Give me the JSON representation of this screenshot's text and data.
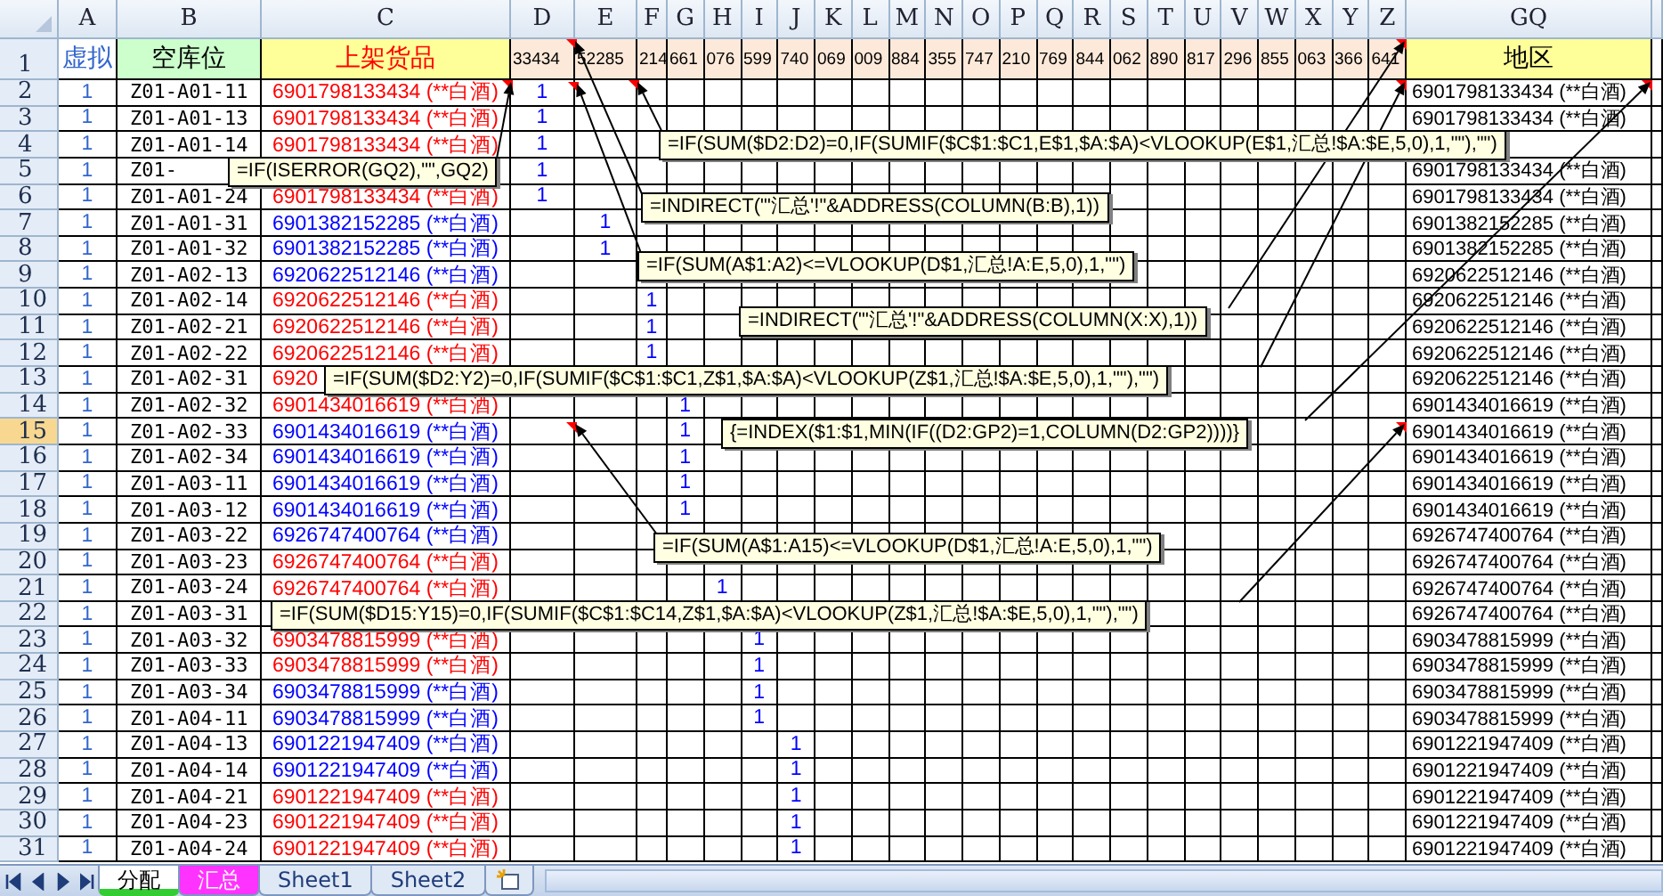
{
  "sheet": {
    "column_headers": [
      "A",
      "B",
      "C",
      "D",
      "E",
      "F",
      "G",
      "H",
      "I",
      "J",
      "K",
      "L",
      "M",
      "N",
      "O",
      "P",
      "Q",
      "R",
      "S",
      "T",
      "U",
      "V",
      "W",
      "X",
      "Y",
      "Z",
      "GQ"
    ],
    "header_row": {
      "row_number": "1",
      "cells": [
        "虚拟",
        "空库位",
        "上架货品",
        "33434",
        "52285",
        "214",
        "661",
        "076",
        "599",
        "740",
        "069",
        "009",
        "884",
        "355",
        "747",
        "210",
        "769",
        "844",
        "062",
        "890",
        "817",
        "296",
        "855",
        "063",
        "366",
        "641",
        "地区"
      ]
    },
    "rows": [
      {
        "row_number": "2",
        "selected": false,
        "a": "1",
        "b": "Z01-A01-11",
        "c": {
          "text": "6901798133434 (**白酒)",
          "color": "#ff0000"
        },
        "marker_text": "1",
        "marker_cells": [
          true,
          false,
          false,
          false,
          false,
          false,
          false,
          false,
          false,
          false,
          false,
          false,
          false,
          false,
          false,
          false,
          false,
          false,
          false,
          false,
          false,
          false,
          false
        ],
        "gq": "6901798133434 (**白酒)"
      },
      {
        "row_number": "3",
        "selected": false,
        "a": "1",
        "b": "Z01-A01-13",
        "c": {
          "text": "6901798133434 (**白酒)",
          "color": "#ff0000"
        },
        "marker_text": "1",
        "marker_cells": [
          true,
          false,
          false,
          false,
          false,
          false,
          false,
          false,
          false,
          false,
          false,
          false,
          false,
          false,
          false,
          false,
          false,
          false,
          false,
          false,
          false,
          false,
          false
        ],
        "gq": "6901798133434 (**白酒)"
      },
      {
        "row_number": "4",
        "selected": false,
        "a": "1",
        "b": "Z01-A01-14",
        "c": {
          "text": "6901798133434 (**白酒)",
          "color": "#ff0000"
        },
        "marker_text": "1",
        "marker_cells": [
          true,
          false,
          false,
          false,
          false,
          false,
          false,
          false,
          false,
          false,
          false,
          false,
          false,
          false,
          false,
          false,
          false,
          false,
          false,
          false,
          false,
          false,
          false
        ]
      },
      {
        "row_number": "5",
        "selected": false,
        "a": "1",
        "b": "Z01-",
        "marker_text": "1",
        "marker_cells": [
          true,
          false,
          false,
          false,
          false,
          false,
          false,
          false,
          false,
          false,
          false,
          false,
          false,
          false,
          false,
          false,
          false,
          false,
          false,
          false,
          false,
          false,
          false
        ],
        "gq": "6901798133434 (**白酒)"
      },
      {
        "row_number": "6",
        "selected": false,
        "a": "1",
        "b": "Z01-A01-24",
        "c": {
          "text": "6901798133434 (**白酒)",
          "color": "#ff0000"
        },
        "marker_text": "1",
        "marker_cells": [
          true,
          false,
          false,
          false,
          false,
          false,
          false,
          false,
          false,
          false,
          false,
          false,
          false,
          false,
          false,
          false,
          false,
          false,
          false,
          false,
          false,
          false,
          false
        ],
        "gq": "6901798133434 (**白酒)"
      },
      {
        "row_number": "7",
        "selected": false,
        "a": "1",
        "b": "Z01-A01-31",
        "c": {
          "text": "6901382152285 (**白酒)",
          "color": "#0000ff"
        },
        "marker_text": "1",
        "marker_cells": [
          false,
          true,
          false,
          false,
          false,
          false,
          false,
          false,
          false,
          false,
          false,
          false,
          false,
          false,
          false,
          false,
          false,
          false,
          false,
          false,
          false,
          false,
          false
        ],
        "gq": "6901382152285 (**白酒)"
      },
      {
        "row_number": "8",
        "selected": false,
        "a": "1",
        "b": "Z01-A01-32",
        "c": {
          "text": "6901382152285 (**白酒)",
          "color": "#0000ff"
        },
        "marker_text": "1",
        "marker_cells": [
          false,
          true,
          false,
          false,
          false,
          false,
          false,
          false,
          false,
          false,
          false,
          false,
          false,
          false,
          false,
          false,
          false,
          false,
          false,
          false,
          false,
          false,
          false
        ],
        "gq": "6901382152285 (**白酒)"
      },
      {
        "row_number": "9",
        "selected": false,
        "a": "1",
        "b": "Z01-A02-13",
        "c": {
          "text": "6920622512146 (**白酒)",
          "color": "#0000ff"
        },
        "gq": "6920622512146 (**白酒)"
      },
      {
        "row_number": "10",
        "selected": false,
        "a": "1",
        "b": "Z01-A02-14",
        "c": {
          "text": "6920622512146 (**白酒)",
          "color": "#ff0000"
        },
        "marker_text": "1",
        "marker_cells": [
          false,
          false,
          true,
          false,
          false,
          false,
          false,
          false,
          false,
          false,
          false,
          false,
          false,
          false,
          false,
          false,
          false,
          false,
          false,
          false,
          false,
          false,
          false
        ],
        "gq": "6920622512146 (**白酒)"
      },
      {
        "row_number": "11",
        "selected": false,
        "a": "1",
        "b": "Z01-A02-21",
        "c": {
          "text": "6920622512146 (**白酒)",
          "color": "#ff0000"
        },
        "marker_text": "1",
        "marker_cells": [
          false,
          false,
          true,
          false,
          false,
          false,
          false,
          false,
          false,
          false,
          false,
          false,
          false,
          false,
          false,
          false,
          false,
          false,
          false,
          false,
          false,
          false,
          false
        ],
        "gq": "6920622512146 (**白酒)"
      },
      {
        "row_number": "12",
        "selected": false,
        "a": "1",
        "b": "Z01-A02-22",
        "c": {
          "text": "6920622512146 (**白酒)",
          "color": "#ff0000"
        },
        "marker_text": "1",
        "marker_cells": [
          false,
          false,
          true,
          false,
          false,
          false,
          false,
          false,
          false,
          false,
          false,
          false,
          false,
          false,
          false,
          false,
          false,
          false,
          false,
          false,
          false,
          false,
          false
        ],
        "gq": "6920622512146 (**白酒)"
      },
      {
        "row_number": "13",
        "selected": false,
        "a": "1",
        "b": "Z01-A02-31",
        "c": {
          "text": "6920",
          "color": "#ff0000"
        },
        "gq": "6920622512146 (**白酒)"
      },
      {
        "row_number": "14",
        "selected": false,
        "a": "1",
        "b": "Z01-A02-32",
        "c": {
          "text": "6901434016619 (**白酒)",
          "color": "#ff0000"
        },
        "marker_text": "1",
        "marker_cells": [
          false,
          false,
          false,
          true,
          false,
          false,
          false,
          false,
          false,
          false,
          false,
          false,
          false,
          false,
          false,
          false,
          false,
          false,
          false,
          false,
          false,
          false,
          false
        ],
        "gq": "6901434016619 (**白酒)"
      },
      {
        "row_number": "15",
        "selected": true,
        "a": "1",
        "b": "Z01-A02-33",
        "c": {
          "text": "6901434016619 (**白酒)",
          "color": "#0000ff"
        },
        "marker_text": "1",
        "marker_cells": [
          false,
          false,
          false,
          true,
          false,
          false,
          false,
          false,
          false,
          false,
          false,
          false,
          false,
          false,
          false,
          false,
          false,
          false,
          false,
          false,
          false,
          false,
          false
        ],
        "gq": "6901434016619 (**白酒)"
      },
      {
        "row_number": "16",
        "selected": false,
        "a": "1",
        "b": "Z01-A02-34",
        "c": {
          "text": "6901434016619 (**白酒)",
          "color": "#0000ff"
        },
        "marker_text": "1",
        "marker_cells": [
          false,
          false,
          false,
          true,
          false,
          false,
          false,
          false,
          false,
          false,
          false,
          false,
          false,
          false,
          false,
          false,
          false,
          false,
          false,
          false,
          false,
          false,
          false
        ],
        "gq": "6901434016619 (**白酒)"
      },
      {
        "row_number": "17",
        "selected": false,
        "a": "1",
        "b": "Z01-A03-11",
        "c": {
          "text": "6901434016619 (**白酒)",
          "color": "#0000ff"
        },
        "marker_text": "1",
        "marker_cells": [
          false,
          false,
          false,
          true,
          false,
          false,
          false,
          false,
          false,
          false,
          false,
          false,
          false,
          false,
          false,
          false,
          false,
          false,
          false,
          false,
          false,
          false,
          false
        ],
        "gq": "6901434016619 (**白酒)"
      },
      {
        "row_number": "18",
        "selected": false,
        "a": "1",
        "b": "Z01-A03-12",
        "c": {
          "text": "6901434016619 (**白酒)",
          "color": "#0000ff"
        },
        "marker_text": "1",
        "marker_cells": [
          false,
          false,
          false,
          true,
          false,
          false,
          false,
          false,
          false,
          false,
          false,
          false,
          false,
          false,
          false,
          false,
          false,
          false,
          false,
          false,
          false,
          false,
          false
        ],
        "gq": "6901434016619 (**白酒)"
      },
      {
        "row_number": "19",
        "selected": false,
        "a": "1",
        "b": "Z01-A03-22",
        "c": {
          "text": "6926747400764 (**白酒)",
          "color": "#0000ff"
        },
        "gq": "6926747400764 (**白酒)"
      },
      {
        "row_number": "20",
        "selected": false,
        "a": "1",
        "b": "Z01-A03-23",
        "c": {
          "text": "6926747400764 (**白酒)",
          "color": "#ff0000"
        },
        "gq": "6926747400764 (**白酒)"
      },
      {
        "row_number": "21",
        "selected": false,
        "a": "1",
        "b": "Z01-A03-24",
        "c": {
          "text": "6926747400764 (**白酒)",
          "color": "#ff0000"
        },
        "marker_text": "1",
        "marker_cells": [
          false,
          false,
          false,
          false,
          true,
          false,
          false,
          false,
          false,
          false,
          false,
          false,
          false,
          false,
          false,
          false,
          false,
          false,
          false,
          false,
          false,
          false,
          false
        ],
        "gq": "6926747400764 (**白酒)"
      },
      {
        "row_number": "22",
        "selected": false,
        "a": "1",
        "b": "Z01-A03-31",
        "gq": "6926747400764 (**白酒)"
      },
      {
        "row_number": "23",
        "selected": false,
        "a": "1",
        "b": "Z01-A03-32",
        "c": {
          "text": "6903478815999 (**白酒)",
          "color": "#ff0000"
        },
        "marker_text": "1",
        "marker_cells": [
          false,
          false,
          false,
          false,
          false,
          true,
          false,
          false,
          false,
          false,
          false,
          false,
          false,
          false,
          false,
          false,
          false,
          false,
          false,
          false,
          false,
          false,
          false
        ],
        "gq": "6903478815999 (**白酒)"
      },
      {
        "row_number": "24",
        "selected": false,
        "a": "1",
        "b": "Z01-A03-33",
        "c": {
          "text": "6903478815999 (**白酒)",
          "color": "#ff0000"
        },
        "marker_text": "1",
        "marker_cells": [
          false,
          false,
          false,
          false,
          false,
          true,
          false,
          false,
          false,
          false,
          false,
          false,
          false,
          false,
          false,
          false,
          false,
          false,
          false,
          false,
          false,
          false,
          false
        ],
        "gq": "6903478815999 (**白酒)"
      },
      {
        "row_number": "25",
        "selected": false,
        "a": "1",
        "b": "Z01-A03-34",
        "c": {
          "text": "6903478815999 (**白酒)",
          "color": "#0000ff"
        },
        "marker_text": "1",
        "marker_cells": [
          false,
          false,
          false,
          false,
          false,
          true,
          false,
          false,
          false,
          false,
          false,
          false,
          false,
          false,
          false,
          false,
          false,
          false,
          false,
          false,
          false,
          false,
          false
        ],
        "gq": "6903478815999 (**白酒)"
      },
      {
        "row_number": "26",
        "selected": false,
        "a": "1",
        "b": "Z01-A04-11",
        "c": {
          "text": "6903478815999 (**白酒)",
          "color": "#0000ff"
        },
        "marker_text": "1",
        "marker_cells": [
          false,
          false,
          false,
          false,
          false,
          true,
          false,
          false,
          false,
          false,
          false,
          false,
          false,
          false,
          false,
          false,
          false,
          false,
          false,
          false,
          false,
          false,
          false
        ],
        "gq": "6903478815999 (**白酒)"
      },
      {
        "row_number": "27",
        "selected": false,
        "a": "1",
        "b": "Z01-A04-13",
        "c": {
          "text": "6901221947409 (**白酒)",
          "color": "#0000ff"
        },
        "marker_text": "1",
        "marker_cells": [
          false,
          false,
          false,
          false,
          false,
          false,
          true,
          false,
          false,
          false,
          false,
          false,
          false,
          false,
          false,
          false,
          false,
          false,
          false,
          false,
          false,
          false,
          false
        ],
        "gq": "6901221947409 (**白酒)"
      },
      {
        "row_number": "28",
        "selected": false,
        "a": "1",
        "b": "Z01-A04-14",
        "c": {
          "text": "6901221947409 (**白酒)",
          "color": "#0000ff"
        },
        "marker_text": "1",
        "marker_cells": [
          false,
          false,
          false,
          false,
          false,
          false,
          true,
          false,
          false,
          false,
          false,
          false,
          false,
          false,
          false,
          false,
          false,
          false,
          false,
          false,
          false,
          false,
          false
        ],
        "gq": "6901221947409 (**白酒)"
      },
      {
        "row_number": "29",
        "selected": false,
        "a": "1",
        "b": "Z01-A04-21",
        "c": {
          "text": "6901221947409 (**白酒)",
          "color": "#ff0000"
        },
        "marker_text": "1",
        "marker_cells": [
          false,
          false,
          false,
          false,
          false,
          false,
          true,
          false,
          false,
          false,
          false,
          false,
          false,
          false,
          false,
          false,
          false,
          false,
          false,
          false,
          false,
          false,
          false
        ],
        "gq": "6901221947409 (**白酒)"
      },
      {
        "row_number": "30",
        "selected": false,
        "a": "1",
        "b": "Z01-A04-23",
        "c": {
          "text": "6901221947409 (**白酒)",
          "color": "#ff0000"
        },
        "marker_text": "1",
        "marker_cells": [
          false,
          false,
          false,
          false,
          false,
          false,
          true,
          false,
          false,
          false,
          false,
          false,
          false,
          false,
          false,
          false,
          false,
          false,
          false,
          false,
          false,
          false,
          false
        ],
        "gq": "6901221947409 (**白酒)"
      },
      {
        "row_number": "31",
        "selected": false,
        "a": "1",
        "b": "Z01-A04-24",
        "c": {
          "text": "6901221947409 (**白酒)",
          "color": "#ff0000"
        },
        "marker_text": "1",
        "marker_cells": [
          false,
          false,
          false,
          false,
          false,
          false,
          true,
          false,
          false,
          false,
          false,
          false,
          false,
          false,
          false,
          false,
          false,
          false,
          false,
          false,
          false,
          false,
          false
        ],
        "gq": "6901221947409 (**白酒)"
      }
    ],
    "comments": [
      {
        "text": "=IF(ISERROR(GQ2),\"\",GQ2)"
      },
      {
        "text": "=IF(SUM($D2:D2)=0,IF(SUMIF($C$1:$C1,E$1,$A:$A)<VLOOKUP(E$1,汇总!$A:$E,5,0),1,\"\"),\"\")"
      },
      {
        "text": "=INDIRECT(\"'汇总'!\"&ADDRESS(COLUMN(B:B),1))"
      },
      {
        "text": "=IF(SUM(A$1:A2)<=VLOOKUP(D$1,汇总!A:E,5,0),1,\"\")"
      },
      {
        "text": "=INDIRECT(\"'汇总'!\"&ADDRESS(COLUMN(X:X),1))"
      },
      {
        "text": "=IF(SUM($D2:Y2)=0,IF(SUMIF($C$1:$C1,Z$1,$A:$A)<VLOOKUP(Z$1,汇总!$A:$E,5,0),1,\"\"),\"\")"
      },
      {
        "text": "{=INDEX($1:$1,MIN(IF((D2:GP2)=1,COLUMN(D2:GP2))))}"
      },
      {
        "text": "=IF(SUM(A$1:A15)<=VLOOKUP(D$1,汇总!A:E,5,0),1,\"\")"
      },
      {
        "text": "=IF(SUM($D15:Y15)=0,IF(SUMIF($C$1:$C14,Z$1,$A:$A)<VLOOKUP(Z$1,汇总!$A:$E,5,0),1,\"\"),\"\")"
      }
    ]
  },
  "sheet_tabs": [
    {
      "label": "分配",
      "selected": true,
      "color": "#33cc33"
    },
    {
      "label": "汇总",
      "selected": false,
      "color": "#ff33ff"
    },
    {
      "label": "Sheet1",
      "selected": false
    },
    {
      "label": "Sheet2",
      "selected": false
    }
  ]
}
